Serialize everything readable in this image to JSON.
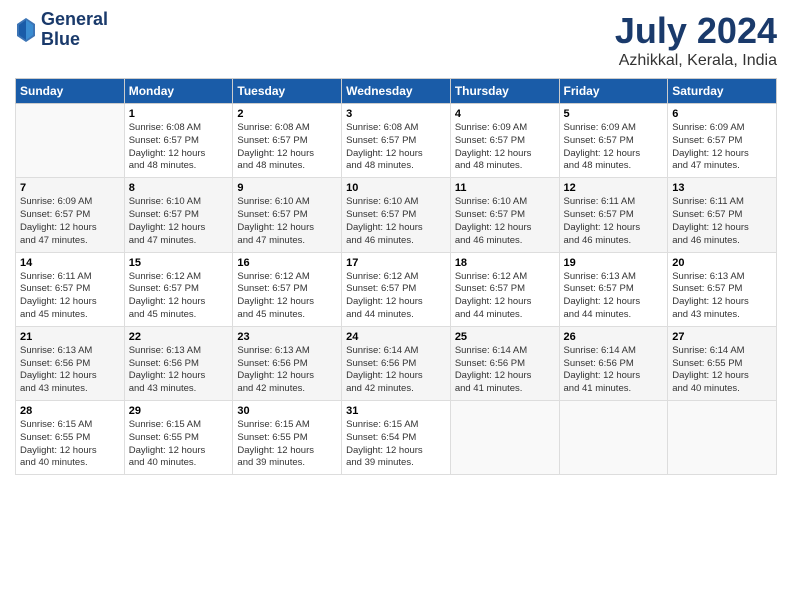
{
  "header": {
    "logo_line1": "General",
    "logo_line2": "Blue",
    "title": "July 2024",
    "subtitle": "Azhikkal, Kerala, India"
  },
  "days_of_week": [
    "Sunday",
    "Monday",
    "Tuesday",
    "Wednesday",
    "Thursday",
    "Friday",
    "Saturday"
  ],
  "weeks": [
    [
      {
        "day": "",
        "info": ""
      },
      {
        "day": "1",
        "info": "Sunrise: 6:08 AM\nSunset: 6:57 PM\nDaylight: 12 hours\nand 48 minutes."
      },
      {
        "day": "2",
        "info": "Sunrise: 6:08 AM\nSunset: 6:57 PM\nDaylight: 12 hours\nand 48 minutes."
      },
      {
        "day": "3",
        "info": "Sunrise: 6:08 AM\nSunset: 6:57 PM\nDaylight: 12 hours\nand 48 minutes."
      },
      {
        "day": "4",
        "info": "Sunrise: 6:09 AM\nSunset: 6:57 PM\nDaylight: 12 hours\nand 48 minutes."
      },
      {
        "day": "5",
        "info": "Sunrise: 6:09 AM\nSunset: 6:57 PM\nDaylight: 12 hours\nand 48 minutes."
      },
      {
        "day": "6",
        "info": "Sunrise: 6:09 AM\nSunset: 6:57 PM\nDaylight: 12 hours\nand 47 minutes."
      }
    ],
    [
      {
        "day": "7",
        "info": "Sunrise: 6:09 AM\nSunset: 6:57 PM\nDaylight: 12 hours\nand 47 minutes."
      },
      {
        "day": "8",
        "info": "Sunrise: 6:10 AM\nSunset: 6:57 PM\nDaylight: 12 hours\nand 47 minutes."
      },
      {
        "day": "9",
        "info": "Sunrise: 6:10 AM\nSunset: 6:57 PM\nDaylight: 12 hours\nand 47 minutes."
      },
      {
        "day": "10",
        "info": "Sunrise: 6:10 AM\nSunset: 6:57 PM\nDaylight: 12 hours\nand 46 minutes."
      },
      {
        "day": "11",
        "info": "Sunrise: 6:10 AM\nSunset: 6:57 PM\nDaylight: 12 hours\nand 46 minutes."
      },
      {
        "day": "12",
        "info": "Sunrise: 6:11 AM\nSunset: 6:57 PM\nDaylight: 12 hours\nand 46 minutes."
      },
      {
        "day": "13",
        "info": "Sunrise: 6:11 AM\nSunset: 6:57 PM\nDaylight: 12 hours\nand 46 minutes."
      }
    ],
    [
      {
        "day": "14",
        "info": "Sunrise: 6:11 AM\nSunset: 6:57 PM\nDaylight: 12 hours\nand 45 minutes."
      },
      {
        "day": "15",
        "info": "Sunrise: 6:12 AM\nSunset: 6:57 PM\nDaylight: 12 hours\nand 45 minutes."
      },
      {
        "day": "16",
        "info": "Sunrise: 6:12 AM\nSunset: 6:57 PM\nDaylight: 12 hours\nand 45 minutes."
      },
      {
        "day": "17",
        "info": "Sunrise: 6:12 AM\nSunset: 6:57 PM\nDaylight: 12 hours\nand 44 minutes."
      },
      {
        "day": "18",
        "info": "Sunrise: 6:12 AM\nSunset: 6:57 PM\nDaylight: 12 hours\nand 44 minutes."
      },
      {
        "day": "19",
        "info": "Sunrise: 6:13 AM\nSunset: 6:57 PM\nDaylight: 12 hours\nand 44 minutes."
      },
      {
        "day": "20",
        "info": "Sunrise: 6:13 AM\nSunset: 6:57 PM\nDaylight: 12 hours\nand 43 minutes."
      }
    ],
    [
      {
        "day": "21",
        "info": "Sunrise: 6:13 AM\nSunset: 6:56 PM\nDaylight: 12 hours\nand 43 minutes."
      },
      {
        "day": "22",
        "info": "Sunrise: 6:13 AM\nSunset: 6:56 PM\nDaylight: 12 hours\nand 43 minutes."
      },
      {
        "day": "23",
        "info": "Sunrise: 6:13 AM\nSunset: 6:56 PM\nDaylight: 12 hours\nand 42 minutes."
      },
      {
        "day": "24",
        "info": "Sunrise: 6:14 AM\nSunset: 6:56 PM\nDaylight: 12 hours\nand 42 minutes."
      },
      {
        "day": "25",
        "info": "Sunrise: 6:14 AM\nSunset: 6:56 PM\nDaylight: 12 hours\nand 41 minutes."
      },
      {
        "day": "26",
        "info": "Sunrise: 6:14 AM\nSunset: 6:56 PM\nDaylight: 12 hours\nand 41 minutes."
      },
      {
        "day": "27",
        "info": "Sunrise: 6:14 AM\nSunset: 6:55 PM\nDaylight: 12 hours\nand 40 minutes."
      }
    ],
    [
      {
        "day": "28",
        "info": "Sunrise: 6:15 AM\nSunset: 6:55 PM\nDaylight: 12 hours\nand 40 minutes."
      },
      {
        "day": "29",
        "info": "Sunrise: 6:15 AM\nSunset: 6:55 PM\nDaylight: 12 hours\nand 40 minutes."
      },
      {
        "day": "30",
        "info": "Sunrise: 6:15 AM\nSunset: 6:55 PM\nDaylight: 12 hours\nand 39 minutes."
      },
      {
        "day": "31",
        "info": "Sunrise: 6:15 AM\nSunset: 6:54 PM\nDaylight: 12 hours\nand 39 minutes."
      },
      {
        "day": "",
        "info": ""
      },
      {
        "day": "",
        "info": ""
      },
      {
        "day": "",
        "info": ""
      }
    ]
  ]
}
